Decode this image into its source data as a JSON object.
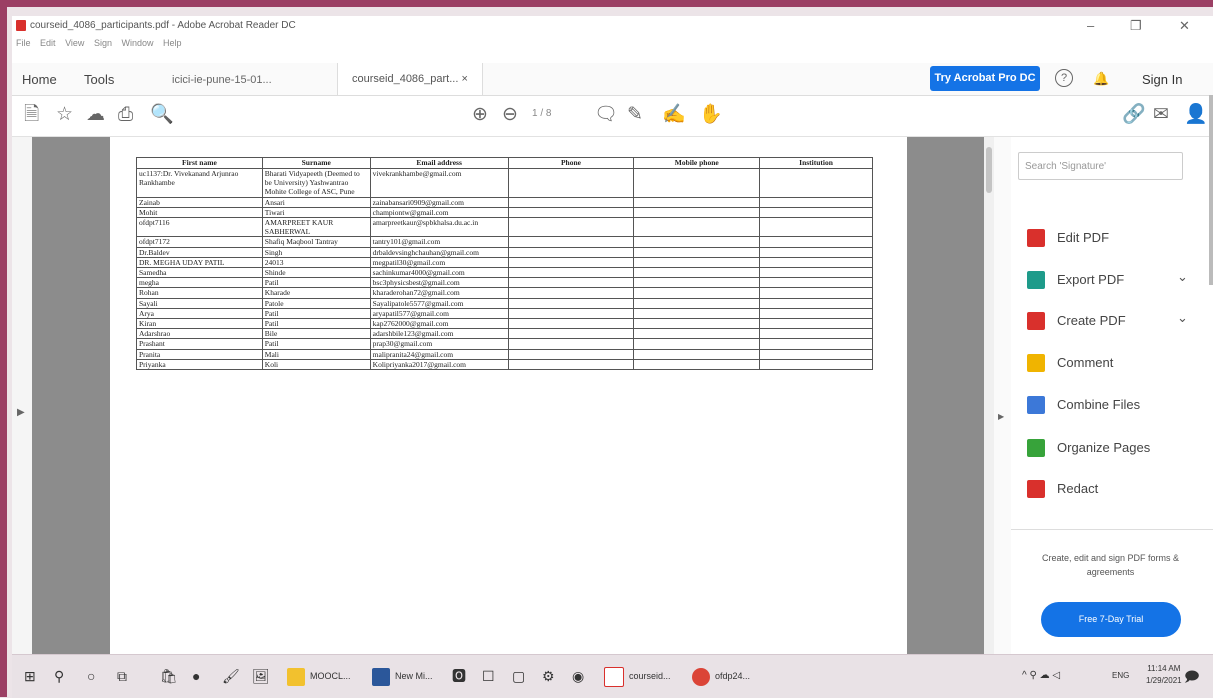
{
  "window": {
    "title": "courseid_4086_participants.pdf - Adobe Acrobat Reader DC",
    "menu": [
      "File",
      "Edit",
      "View",
      "Sign",
      "Window",
      "Help"
    ]
  },
  "tabs": {
    "home": "Home",
    "tools": "Tools",
    "doc1": "icici-ie-pune-15-01...",
    "doc2": "courseid_4086_part...",
    "try_pro": "Try Acrobat Pro DC",
    "sign_in": "Sign In"
  },
  "toolbar": {
    "page_current": "1",
    "page_total": "/ 8"
  },
  "table": {
    "headers": [
      "First name",
      "Surname",
      "Email address",
      "Phone",
      "Mobile phone",
      "Institution"
    ],
    "rows": [
      [
        "uc1137:Dr. Vivekanand Arjunrao Rankhambe",
        "Bharati Vidyapeeth (Deemed to be University) Yashwantrao Mohite College of ASC, Pune",
        "vivekrankhambe@gmail.com",
        "",
        "",
        ""
      ],
      [
        "Zainab",
        "Ansari",
        "zainabansari0909@gmail.com",
        "",
        "",
        ""
      ],
      [
        "Mohit",
        "Tiwari",
        "championtw@gmail.com",
        "",
        "",
        ""
      ],
      [
        "ofdpt7116",
        "AMARPREET KAUR SABHERWAL",
        "amarpreetkaur@spbkhalsa.du.ac.in",
        "",
        "",
        ""
      ],
      [
        "ofdpt7172",
        "Shafiq Maqbool Tantray",
        "tantry101@gmail.com",
        "",
        "",
        ""
      ],
      [
        "Dr.Baldev",
        "Singh",
        "drbaldevsinghchauhan@gmail.com",
        "",
        "",
        ""
      ],
      [
        "DR. MEGHA UDAY PATIL",
        "24013",
        "megpatil30@gmail.com",
        "",
        "",
        ""
      ],
      [
        "Samedha",
        "Shinde",
        "sachinkumar4000@gmail.com",
        "",
        "",
        ""
      ],
      [
        "megha",
        "Patil",
        "bsc3physicsbest@gmail.com",
        "",
        "",
        ""
      ],
      [
        "Rohan",
        "Kharade",
        "kharaderohan72@gmail.com",
        "",
        "",
        ""
      ],
      [
        "Sayali",
        "Patole",
        "Sayalipatole5577@gmail.com",
        "",
        "",
        ""
      ],
      [
        "Arya",
        "Patil",
        "aryapatil577@gmail.com",
        "",
        "",
        ""
      ],
      [
        "Kiran",
        "Patil",
        "kap2762000@gmail.com",
        "",
        "",
        ""
      ],
      [
        "Adarshrao",
        "Bile",
        "adarshbile123@gmail.com",
        "",
        "",
        ""
      ],
      [
        "Prashant",
        "Patil",
        "prap30@gmail.com",
        "",
        "",
        ""
      ],
      [
        "Pranita",
        "Mali",
        "malipranita24@gmail.com",
        "",
        "",
        ""
      ],
      [
        "Priyanka",
        "Koli",
        "Kolipriyanka2017@gmail.com",
        "",
        "",
        ""
      ]
    ]
  },
  "right_pane": {
    "search_placeholder": "Search 'Signature'",
    "tools": [
      {
        "label": "Edit PDF",
        "color": "#d9302c"
      },
      {
        "label": "Export PDF",
        "color": "#1e9b8a"
      },
      {
        "label": "Create PDF",
        "color": "#d9302c"
      },
      {
        "label": "Comment",
        "color": "#f0b400"
      },
      {
        "label": "Combine Files",
        "color": "#3c78d8"
      },
      {
        "label": "Organize Pages",
        "color": "#37a33a"
      },
      {
        "label": "Redact",
        "color": "#d9302c"
      }
    ],
    "promo_text": "Create, edit and sign PDF forms & agreements",
    "trial_button": "Free 7-Day Trial"
  },
  "taskbar": {
    "apps": [
      "MOOCL...",
      "New Mi...",
      "courseid...",
      "ofdp24..."
    ],
    "lang": "ENG",
    "time": "11:14 AM",
    "date": "1/29/2021"
  }
}
